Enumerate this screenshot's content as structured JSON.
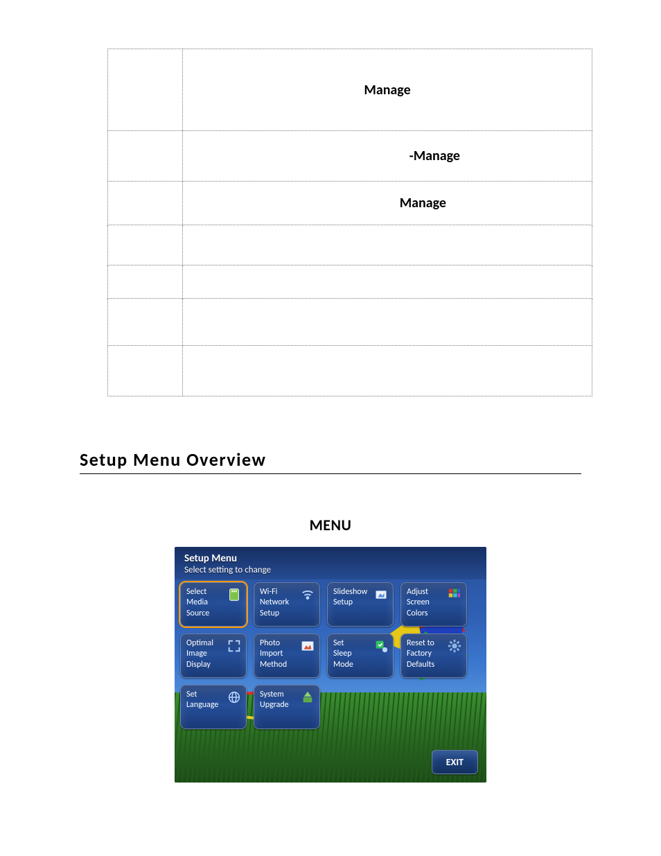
{
  "table": {
    "rows": [
      {
        "c1": "",
        "c2": "Manage"
      },
      {
        "c1": "",
        "c2": "-Manage"
      },
      {
        "c1": "",
        "c2": "Manage"
      },
      {
        "c1": "",
        "c2": ""
      },
      {
        "c1": "",
        "c2": ""
      },
      {
        "c1": "",
        "c2": ""
      },
      {
        "c1": "",
        "c2": ""
      }
    ]
  },
  "heading": "Setup Menu Overview",
  "menu_label": "MENU",
  "setup": {
    "title": "Setup Menu",
    "subtitle": "Select setting to change",
    "tiles": [
      {
        "l1": "Select",
        "l2": "Media",
        "l3": "Source",
        "selected": true,
        "icon": "sd-card-icon"
      },
      {
        "l1": "Wi-Fi",
        "l2": "Network",
        "l3": "Setup",
        "icon": "wifi-icon"
      },
      {
        "l1": "",
        "l2": "Slideshow",
        "l3": "Setup",
        "icon": "slideshow-icon"
      },
      {
        "l1": "Adjust",
        "l2": "Screen",
        "l3": "Colors",
        "icon": "color-grid-icon"
      },
      {
        "l1": "Optimal",
        "l2": "Image",
        "l3": "Display",
        "icon": "expand-icon"
      },
      {
        "l1": "Photo",
        "l2": "Import",
        "l3": "Method",
        "icon": "import-icon"
      },
      {
        "l1": "Set",
        "l2": "Sleep",
        "l3": "Mode",
        "icon": "sleep-icon"
      },
      {
        "l1": "Reset to",
        "l2": "Factory",
        "l3": "Defaults",
        "icon": "gear-icon"
      },
      {
        "l1": "",
        "l2": "Set",
        "l3": "Language",
        "icon": "globe-icon"
      },
      {
        "l1": "",
        "l2": "System",
        "l3": "Upgrade",
        "icon": "upgrade-icon"
      }
    ],
    "exit": "EXIT"
  }
}
